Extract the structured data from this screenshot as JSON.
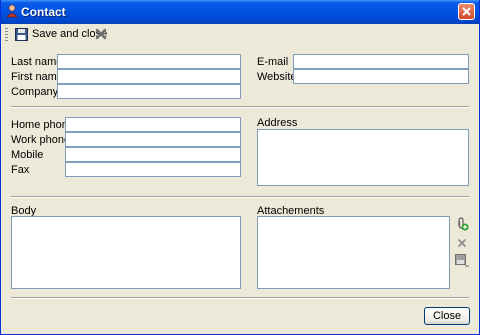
{
  "window": {
    "title": "Contact"
  },
  "toolbar": {
    "save_label": "Save and close"
  },
  "fields": {
    "last_name": {
      "label": "Last name",
      "value": ""
    },
    "first_name": {
      "label": "First name",
      "value": ""
    },
    "company": {
      "label": "Company",
      "value": ""
    },
    "email": {
      "label": "E-mail",
      "value": ""
    },
    "website": {
      "label": "Website",
      "value": ""
    },
    "home_phone": {
      "label": "Home phone",
      "value": ""
    },
    "work_phone": {
      "label": "Work phone",
      "value": ""
    },
    "mobile": {
      "label": "Mobile",
      "value": ""
    },
    "fax": {
      "label": "Fax",
      "value": ""
    },
    "address": {
      "label": "Address",
      "value": ""
    }
  },
  "body": {
    "label": "Body",
    "value": ""
  },
  "attachments": {
    "label": "Attachements"
  },
  "footer": {
    "close_label": "Close"
  },
  "colors": {
    "title_bar": "#0055e5",
    "input_border": "#7f9db9",
    "window_bg": "#ece9d8"
  }
}
